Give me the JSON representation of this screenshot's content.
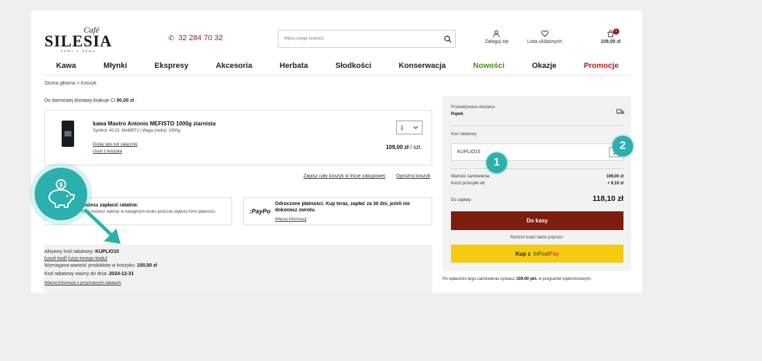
{
  "header": {
    "logo": {
      "cafe": "Café",
      "name": "SILESIA",
      "tagline": "KAWY  ∨  KAWA"
    },
    "phone": "32 284 70 32",
    "search_placeholder": "Wpisz czego szukasz",
    "login_label": "Zaloguj się",
    "wishlist_label": "Lista ulubionych",
    "cart_total": "109,00 zł",
    "cart_count": "1"
  },
  "nav": {
    "items": [
      {
        "label": "Kawa"
      },
      {
        "label": "Młynki"
      },
      {
        "label": "Ekspresy"
      },
      {
        "label": "Akcesoria"
      },
      {
        "label": "Herbata"
      },
      {
        "label": "Słodkości"
      },
      {
        "label": "Konserwacja"
      },
      {
        "label": "Nowości",
        "color": "#4f8a1c"
      },
      {
        "label": "Okazje"
      },
      {
        "label": "Promocje",
        "color": "#c0161d"
      }
    ]
  },
  "breadcrumb": "Strona główna > Koszyk",
  "free_shipping": {
    "prefix": "Do darmowej dostawy brakuje Ci",
    "amount": "90,00 zł",
    "suffix": "."
  },
  "product": {
    "name": "kawa Mastro Antonio MEFISTO 1000g ziarnista",
    "meta": "Symbol: 40.02. MAMEF1   |   Waga (netto): 1000g",
    "add_note_link": "Dodaj opis lub załącznik",
    "remove_link": "Usuń z koszyka",
    "quantity": "1",
    "price": "109,00 zł",
    "price_unit": "/ szt."
  },
  "cart_actions": {
    "save_list": "Zapisz cały koszyk w liście zakupowej",
    "empty_cart": "Opróżnij koszyk"
  },
  "payments": {
    "installments": {
      "title": "Możesz zapłacić ratalnie.",
      "text": "Ratę możesz wybrać w następnym kroku podczas wyboru form płatności."
    },
    "paypo": {
      "logo": ":PayPo",
      "title": "Odroczone płatności. Kup teraz, zapłać za 30 dni, jeżeli nie dokonasz zwrotu.",
      "link": "Więcej informacji"
    }
  },
  "active_coupon": {
    "label": "Aktywny kod rabatowy:",
    "code": "KUPLIO15",
    "remove_link": "[usuń kod]",
    "other_link": "[użyj innego kodu]",
    "min_value_label": "Wymagana wartość produktów w koszyku:",
    "min_value": "100,00 zł",
    "valid_label": "Kod rabatowy ważny do dnia:",
    "valid_date": "2024-12-31",
    "more_link": "Więcej informacji o przyznanych rabatach"
  },
  "summary": {
    "delivery_label": "Przewidywana dostawa:",
    "delivery_day": "Piątek",
    "coupon_label": "Kod rabatowy",
    "coupon_value": "KUPLIO15",
    "order_value_label": "Wartość zamówienia:",
    "order_value": "109,00 zł",
    "shipping_label": "Koszt przesyłki od:",
    "shipping_value": "+ 9,10 zł",
    "total_label": "Do zapłaty:",
    "total_value": "118,10 zł",
    "checkout_label": "Do kasy",
    "alt_label": "Możesz kupić także poprzez:",
    "inpost_prefix": "Kup z",
    "inpost_brand": "InPost",
    "inpost_pay": "Pay"
  },
  "loyalty": {
    "prefix": "Po opłaceniu tego zamówienia zyskasz",
    "points": "109.00 pkt.",
    "suffix": "w programie lojalnościowym."
  },
  "markers": {
    "one": "1",
    "two": "2"
  },
  "colors": {
    "accent_teal": "#2bb0ad",
    "checkout_red": "#7c1d0f",
    "inpost_yellow": "#f5cb12",
    "brand_red": "#8b1e1e"
  }
}
